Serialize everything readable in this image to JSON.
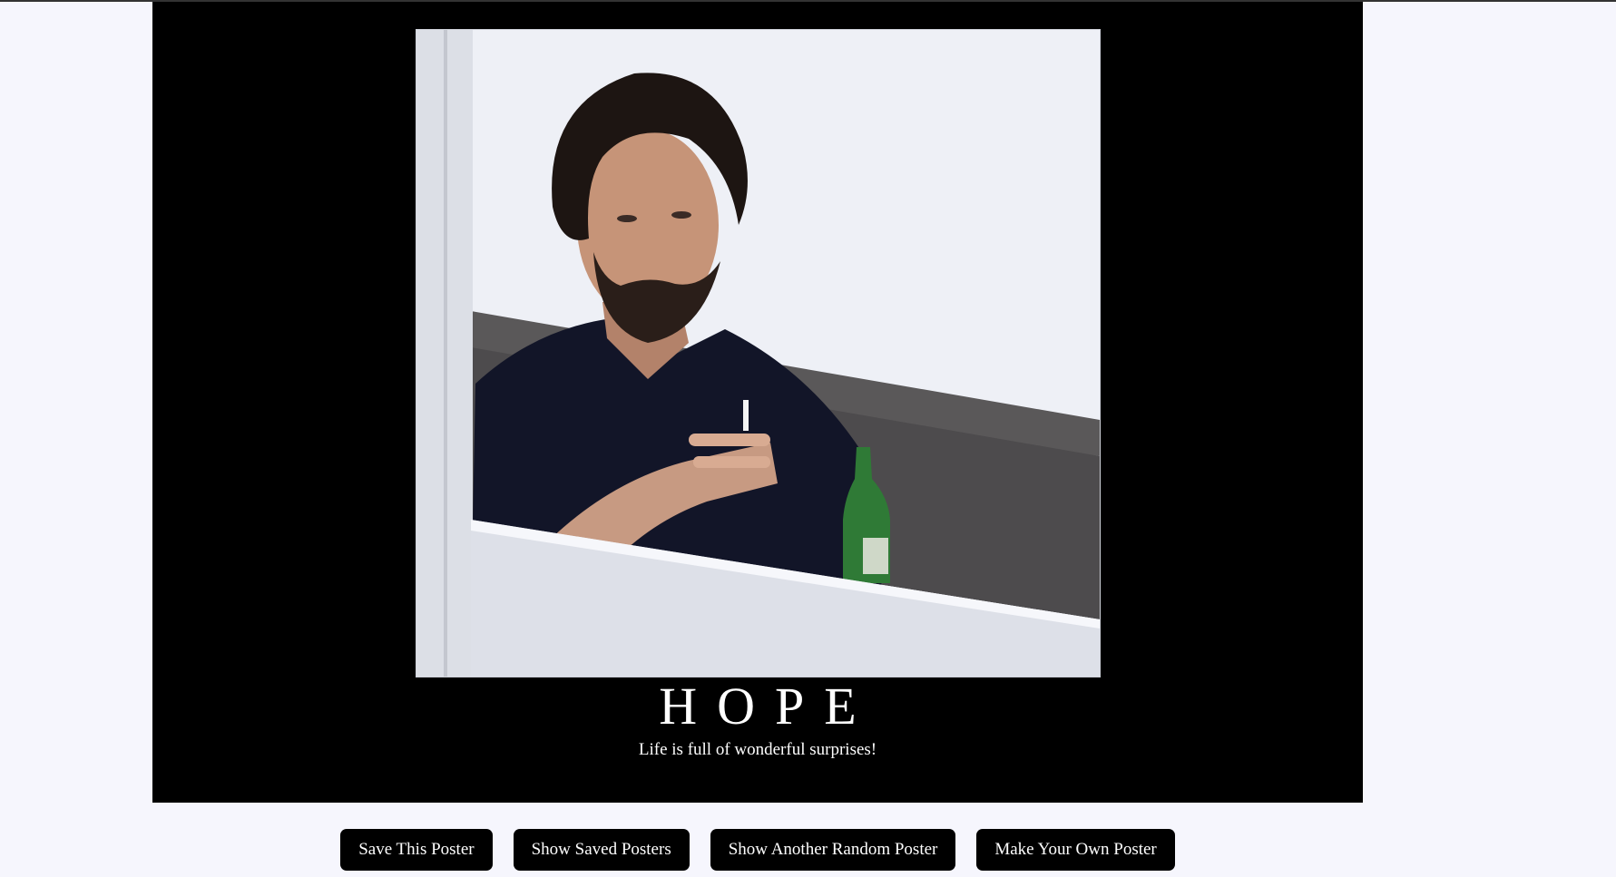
{
  "poster": {
    "image_alt": "motivational poster photo",
    "title": "HOPE",
    "quote": "Life is full of wonderful surprises!"
  },
  "buttons": {
    "save": "Save This Poster",
    "show_saved": "Show Saved Posters",
    "random": "Show Another Random Poster",
    "make_own": "Make Your Own Poster"
  },
  "colors": {
    "page_background": "#f6f6fd",
    "poster_background": "#000000",
    "button_background": "#000000",
    "button_text": "#ffffff"
  }
}
